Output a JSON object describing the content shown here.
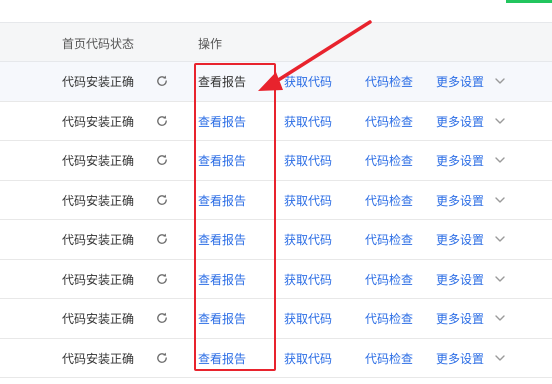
{
  "table": {
    "headers": {
      "status": "首页代码状态",
      "actions": "操作"
    },
    "rows": [
      {
        "status": "代码安装正确",
        "report": "查看报告",
        "get_code": "获取代码",
        "check_code": "代码检查",
        "more": "更多设置",
        "icons": {
          "refresh": "refresh-icon",
          "expand": "chevron-down-icon"
        }
      },
      {
        "status": "代码安装正确",
        "report": "查看报告",
        "get_code": "获取代码",
        "check_code": "代码检查",
        "more": "更多设置",
        "icons": {
          "refresh": "refresh-icon",
          "expand": "chevron-down-icon"
        }
      },
      {
        "status": "代码安装正确",
        "report": "查看报告",
        "get_code": "获取代码",
        "check_code": "代码检查",
        "more": "更多设置",
        "icons": {
          "refresh": "refresh-icon",
          "expand": "chevron-down-icon"
        }
      },
      {
        "status": "代码安装正确",
        "report": "查看报告",
        "get_code": "获取代码",
        "check_code": "代码检查",
        "more": "更多设置",
        "icons": {
          "refresh": "refresh-icon",
          "expand": "chevron-down-icon"
        }
      },
      {
        "status": "代码安装正确",
        "report": "查看报告",
        "get_code": "获取代码",
        "check_code": "代码检查",
        "more": "更多设置",
        "icons": {
          "refresh": "refresh-icon",
          "expand": "chevron-down-icon"
        }
      },
      {
        "status": "代码安装正确",
        "report": "查看报告",
        "get_code": "获取代码",
        "check_code": "代码检查",
        "more": "更多设置",
        "icons": {
          "refresh": "refresh-icon",
          "expand": "chevron-down-icon"
        }
      },
      {
        "status": "代码安装正确",
        "report": "查看报告",
        "get_code": "获取代码",
        "check_code": "代码检查",
        "more": "更多设置",
        "icons": {
          "refresh": "refresh-icon",
          "expand": "chevron-down-icon"
        }
      },
      {
        "status": "代码安装正确",
        "report": "查看报告",
        "get_code": "获取代码",
        "check_code": "代码检查",
        "more": "更多设置",
        "icons": {
          "refresh": "refresh-icon",
          "expand": "chevron-down-icon"
        }
      }
    ]
  },
  "colors": {
    "link": "#2b6de5",
    "annotation_red": "#e8232d",
    "header_bg": "#f5f6f7",
    "hover_row_bg": "#f6f8fc",
    "accent_green": "#22c55e"
  }
}
